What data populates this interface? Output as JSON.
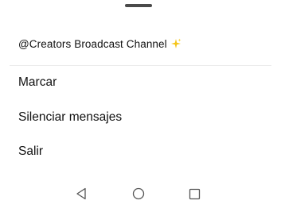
{
  "header": {
    "title": "@Creators Broadcast Channel",
    "icon": "sparkle-icon",
    "icon_color": "#f5c518"
  },
  "menu": {
    "items": [
      {
        "label": "Marcar"
      },
      {
        "label": "Silenciar mensajes"
      },
      {
        "label": "Salir"
      }
    ]
  },
  "navigation": {
    "icons": [
      "back-triangle-icon",
      "home-circle-icon",
      "recents-square-icon"
    ],
    "icon_color": "#555555"
  }
}
